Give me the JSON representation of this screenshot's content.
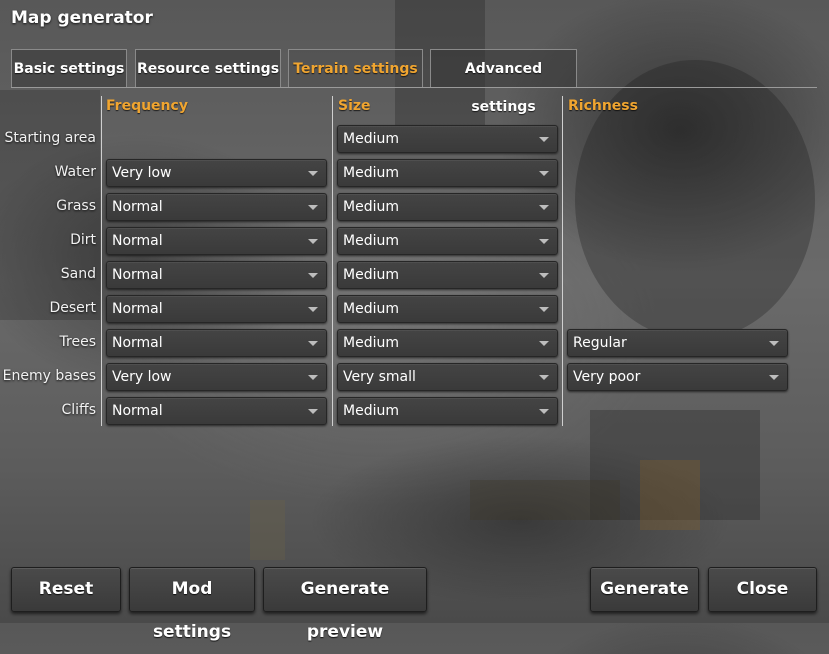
{
  "window": {
    "title": "Map generator"
  },
  "tabs": [
    {
      "label": "Basic settings",
      "active": false
    },
    {
      "label": "Resource settings",
      "active": false
    },
    {
      "label": "Terrain settings",
      "active": true
    },
    {
      "label": "Advanced settings",
      "active": false
    }
  ],
  "columns": {
    "frequency": "Frequency",
    "size": "Size",
    "richness": "Richness"
  },
  "rows": [
    {
      "label": "Starting area",
      "frequency": null,
      "size": "Medium",
      "richness": null
    },
    {
      "label": "Water",
      "frequency": "Very low",
      "size": "Medium",
      "richness": null
    },
    {
      "label": "Grass",
      "frequency": "Normal",
      "size": "Medium",
      "richness": null
    },
    {
      "label": "Dirt",
      "frequency": "Normal",
      "size": "Medium",
      "richness": null
    },
    {
      "label": "Sand",
      "frequency": "Normal",
      "size": "Medium",
      "richness": null
    },
    {
      "label": "Desert",
      "frequency": "Normal",
      "size": "Medium",
      "richness": null
    },
    {
      "label": "Trees",
      "frequency": "Normal",
      "size": "Medium",
      "richness": "Regular"
    },
    {
      "label": "Enemy bases",
      "frequency": "Very low",
      "size": "Very small",
      "richness": "Very poor"
    },
    {
      "label": "Cliffs",
      "frequency": "Normal",
      "size": "Medium",
      "richness": null
    }
  ],
  "buttons": {
    "reset": "Reset",
    "mod_settings": "Mod settings",
    "generate_preview": "Generate preview",
    "generate": "Generate",
    "close": "Close"
  },
  "colors": {
    "accent": "#f0a530",
    "dropdown": "#404040",
    "text": "#ffffff"
  },
  "icons": {
    "dropdown": "chevron-down-icon"
  }
}
